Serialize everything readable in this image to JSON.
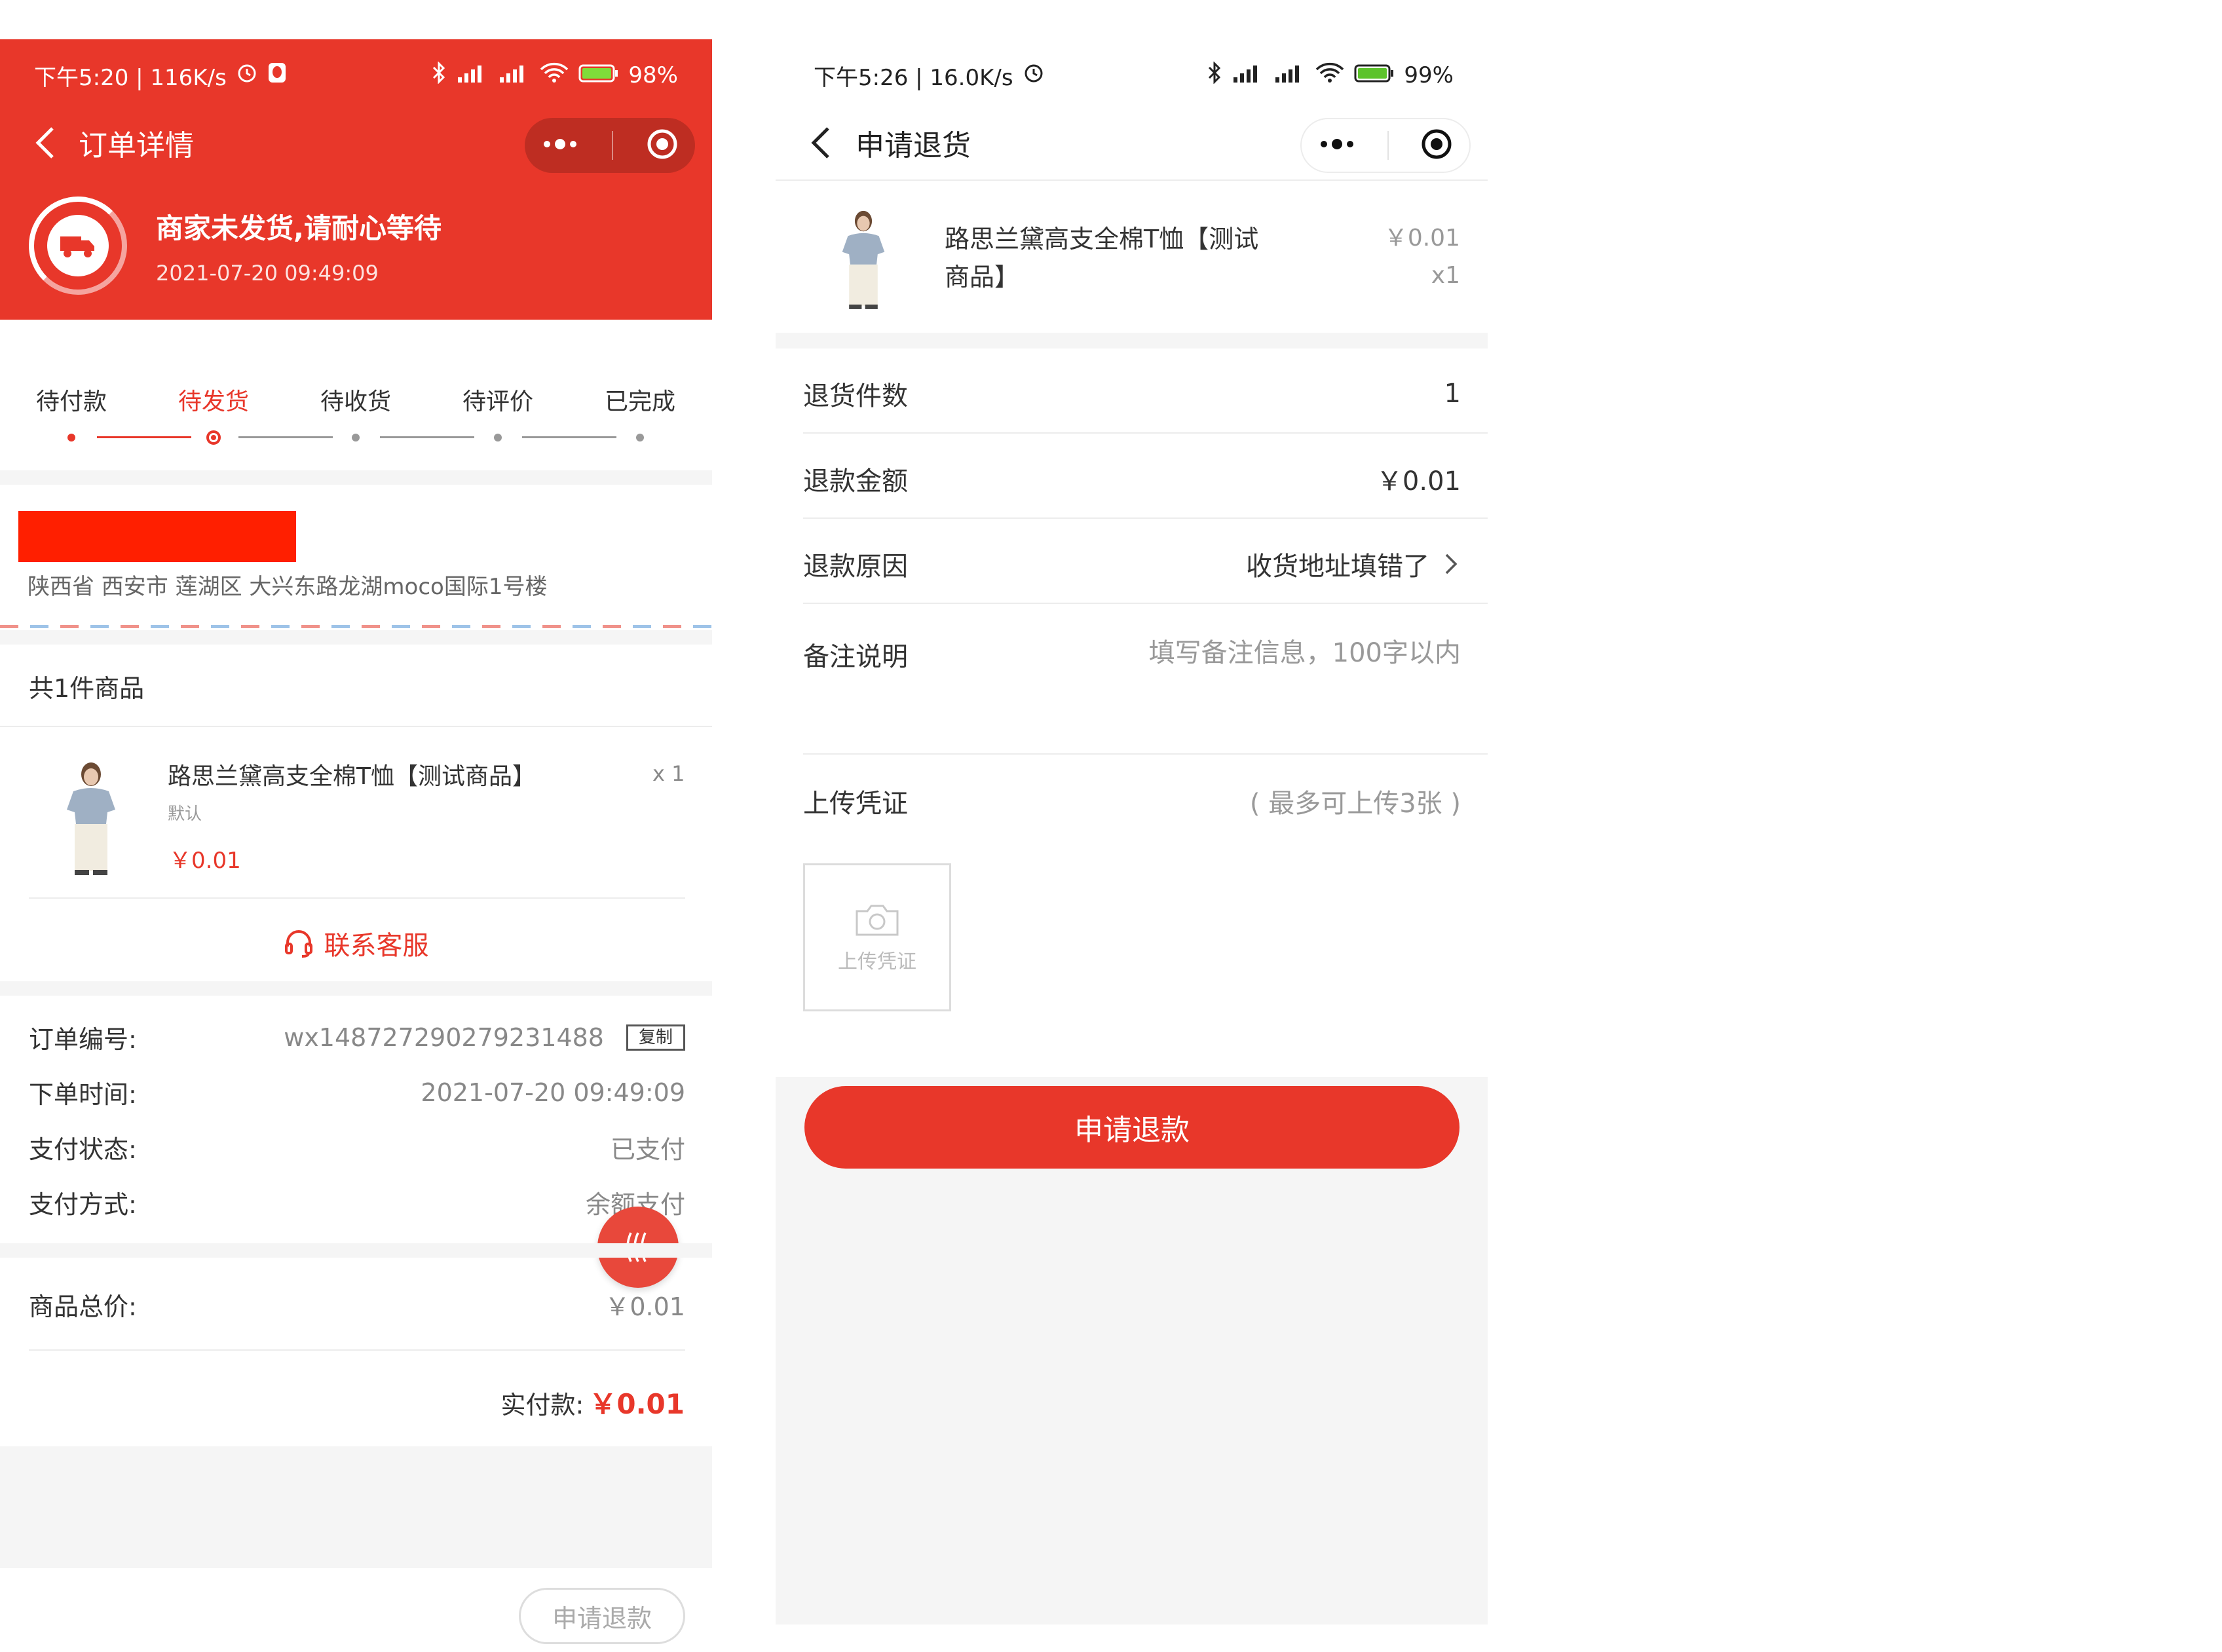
{
  "left": {
    "status_bar": {
      "time": "下午5:20 | 116K/s",
      "battery": "98%"
    },
    "nav": {
      "title": "订单详情"
    },
    "shipping": {
      "title": "商家未发货,请耐心等待",
      "time": "2021-07-20   09:49:09"
    },
    "steps": [
      {
        "label": "待付款"
      },
      {
        "label": "待发货"
      },
      {
        "label": "待收货"
      },
      {
        "label": "待评价"
      },
      {
        "label": "已完成"
      }
    ],
    "address": "陕西省 西安市 莲湖区 大兴东路龙湖moco国际1号楼",
    "goods_count": "共1件商品",
    "product": {
      "name": "路思兰黛高支全棉T恤【测试商品】",
      "qty": "x 1",
      "spec": "默认",
      "price": "￥0.01"
    },
    "contact_service": "联系客服",
    "order_info": [
      {
        "label": "订单编号:",
        "value": "wx148727290279231488",
        "action": "复制"
      },
      {
        "label": "下单时间:",
        "value": "2021-07-20 09:49:09"
      },
      {
        "label": "支付状态:",
        "value": "已支付"
      },
      {
        "label": "支付方式:",
        "value": "余额支付"
      }
    ],
    "total": {
      "label": "商品总价:",
      "value": "￥0.01"
    },
    "paid": {
      "label": "实付款:",
      "value": "￥0.01"
    },
    "refund_button": "申请退款"
  },
  "right": {
    "status_bar": {
      "time": "下午5:26 | 16.0K/s",
      "battery": "99%"
    },
    "nav": {
      "title": "申请退货"
    },
    "product": {
      "name_line1": "路思兰黛高支全棉T恤【测试",
      "name_line2": "商品】",
      "price": "￥0.01",
      "qty": "x1"
    },
    "form": {
      "return_count": {
        "label": "退货件数",
        "value": "1"
      },
      "refund_amount": {
        "label": "退款金额",
        "value": "￥0.01"
      },
      "refund_reason": {
        "label": "退款原因",
        "value": "收货地址填错了"
      },
      "remark": {
        "label": "备注说明",
        "placeholder": "填写备注信息，100字以内"
      },
      "voucher": {
        "label": "上传凭证",
        "hint": "( 最多可上传3张 )",
        "upload_label": "上传凭证"
      }
    },
    "submit_button": "申请退款"
  },
  "colors": {
    "brand_red": "#e8372a",
    "redaction": "#ff1f00",
    "page_gray": "#f5f5f5"
  },
  "icons": [
    "back-chevron-icon",
    "more-dots-icon",
    "close-target-icon",
    "truck-icon",
    "headset-icon",
    "scroll-top-icon",
    "chevron-right-icon",
    "camera-icon",
    "bluetooth-icon",
    "signal-icon",
    "wifi-icon",
    "battery-icon",
    "alarm-icon"
  ]
}
